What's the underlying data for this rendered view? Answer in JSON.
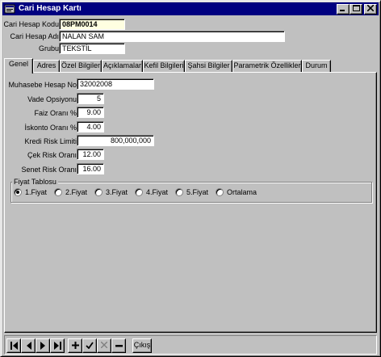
{
  "window": {
    "title": "Cari Hesap Kartı",
    "icons": [
      "app-icon",
      "minimize-icon",
      "maximize-icon",
      "close-icon"
    ],
    "titlebar_color": "#000080"
  },
  "header": {
    "code_label": "Cari Hesap Kodu",
    "code_value": "08PM0014",
    "name_label": "Cari Hesap Adı",
    "name_value": "NALAN SAM",
    "group_label": "Grubu",
    "group_value": "TEKSTİL"
  },
  "tabs": [
    "Genel",
    "Adres",
    "Özel Bilgiler",
    "Açıklamalar",
    "Kefil Bilgileri",
    "Şahsi Bilgiler",
    "Parametrik Özellikler",
    "Durum"
  ],
  "active_tab": "Genel",
  "form": {
    "muhasebe_label": "Muhasebe Hesap No",
    "muhasebe_value": "32002008",
    "vade_label": "Vade Opsiyonu",
    "vade_value": "5",
    "faiz_label": "Faiz Oranı %",
    "faiz_value": "9.00",
    "iskonto_label": "İskonto Oranı %",
    "iskonto_value": "4.00",
    "kredi_label": "Kredi Risk Limiti",
    "kredi_value": "800,000,000",
    "cek_label": "Çek Risk Oranı",
    "cek_value": "12.00",
    "senet_label": "Senet Risk Oranı",
    "senet_value": "16.00"
  },
  "fiyat": {
    "legend": "Fiyat Tablosu",
    "options": [
      "1.Fiyat",
      "2.Fiyat",
      "3.Fiyat",
      "4.Fiyat",
      "5.Fiyat",
      "Ortalama"
    ],
    "selected": "1.Fiyat"
  },
  "navigator": {
    "buttons": [
      "first-icon",
      "prior-icon",
      "next-icon",
      "last-icon",
      "insert-icon",
      "post-icon",
      "cancel-icon",
      "delete-icon"
    ],
    "exit_label": "Çıkış"
  }
}
